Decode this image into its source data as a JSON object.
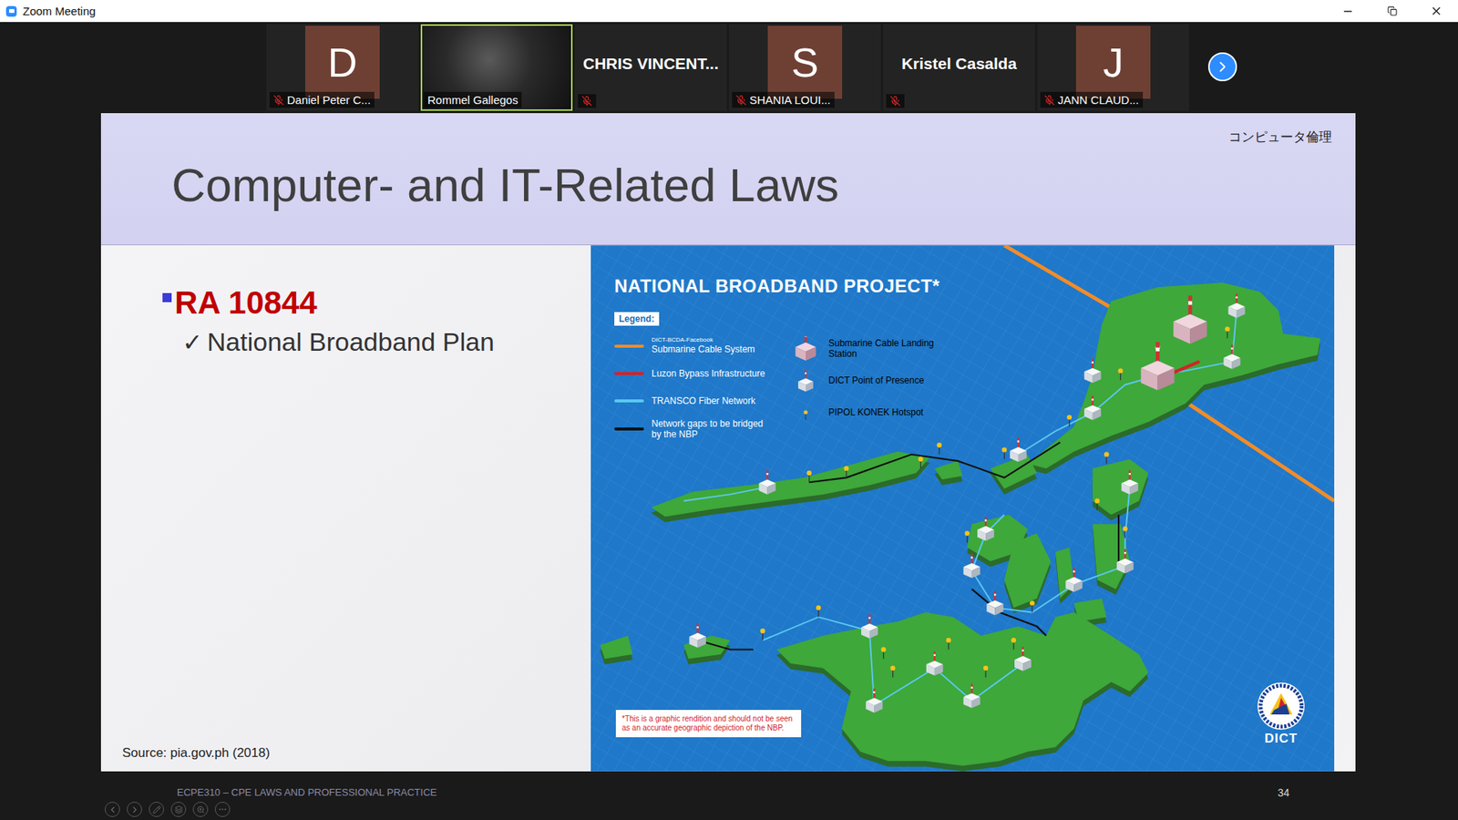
{
  "window": {
    "title": "Zoom Meeting"
  },
  "participants": [
    {
      "name": "Daniel Peter C...",
      "initial": "D",
      "kind": "avatar",
      "muted": true,
      "speaking": false
    },
    {
      "name": "Rommel Gallegos",
      "kind": "video",
      "muted": false,
      "speaking": true
    },
    {
      "name": "CHRIS  VINCENT...",
      "kind": "name",
      "muted": true,
      "speaking": false
    },
    {
      "name": "SHANIA LOUI...",
      "initial": "S",
      "kind": "avatar",
      "muted": true,
      "speaking": false
    },
    {
      "name": "Kristel Casalda",
      "kind": "name",
      "muted": true,
      "speaking": false
    },
    {
      "name": "JANN CLAUD...",
      "initial": "J",
      "kind": "avatar",
      "muted": true,
      "speaking": false
    }
  ],
  "slide": {
    "title": "Computer- and IT-Related Laws",
    "tag": "コンピュータ倫理",
    "bullets": [
      {
        "text": "RA 10844",
        "subs": [
          {
            "mark": "✓",
            "text": "National Broadband Plan"
          }
        ]
      }
    ],
    "source": "Source: pia.gov.ph (2018)",
    "footer": "ECPE310 – CPE LAWS AND PROFESSIONAL PRACTICE",
    "page": "34"
  },
  "map": {
    "title": "NATIONAL BROADBAND PROJECT*",
    "legend_label": "Legend:",
    "lines": [
      {
        "sublabel": "DICT-BCDA-Facebook",
        "label": "Submarine Cable System",
        "color": "#f28c28"
      },
      {
        "sublabel": "",
        "label": "Luzon Bypass Infrastructure",
        "color": "#d2232a"
      },
      {
        "sublabel": "",
        "label": "TRANSCO Fiber Network",
        "color": "#5bc8f0"
      },
      {
        "sublabel": "",
        "label": "Network gaps to be bridged by the NBP",
        "color": "#111111"
      }
    ],
    "markers": [
      {
        "label": "Submarine Cable Landing Station",
        "kind": "landing"
      },
      {
        "label": "DICT Point of Presence",
        "kind": "pop"
      },
      {
        "label": "PIPOL KONEK Hotspot",
        "kind": "hotspot"
      }
    ],
    "note": "*This is a graphic rendition and should not be seen as an accurate geographic depiction of the NBP.",
    "logo": "DICT"
  }
}
